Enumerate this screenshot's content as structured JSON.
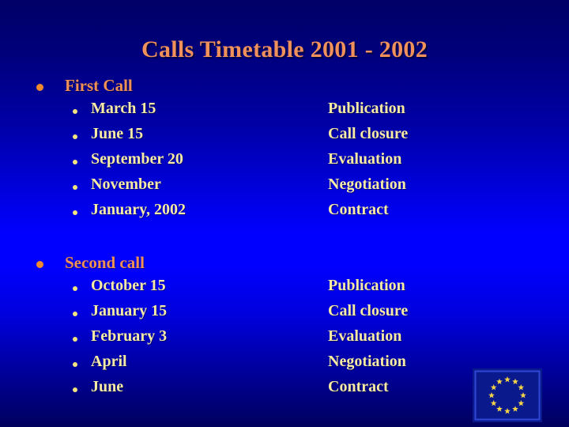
{
  "slide": {
    "title": "Calls Timetable 2001 - 2002",
    "title_color": "#f09055",
    "item_color": "#f7eaa6",
    "bullet_color": "#ef8a2e",
    "sub_bullet_color": "#f2e47e",
    "background_top_color": "#000066",
    "background_mid_color": "#0000ff",
    "background_bottom_color": "#00005e"
  },
  "sections": [
    {
      "heading": "First Call",
      "items": [
        {
          "date": "March 15",
          "stage": "Publication"
        },
        {
          "date": "June 15",
          "stage": "Call closure"
        },
        {
          "date": "September 20",
          "stage": "Evaluation"
        },
        {
          "date": "November",
          "stage": "Negotiation"
        },
        {
          "date": "January, 2002",
          "stage": "Contract"
        }
      ]
    },
    {
      "heading": "Second call",
      "items": [
        {
          "date": "October 15",
          "stage": "Publication"
        },
        {
          "date": "January 15",
          "stage": "Call closure"
        },
        {
          "date": "February 3",
          "stage": "Evaluation"
        },
        {
          "date": "April",
          "stage": "Negotiation"
        },
        {
          "date": "June",
          "stage": "Contract"
        }
      ]
    }
  ],
  "logo": {
    "name": "european-union-flag",
    "star_count": 12,
    "star_color": "#f5d547",
    "field_color": "#0a1a8c",
    "border_color": "#2a3fd0"
  }
}
